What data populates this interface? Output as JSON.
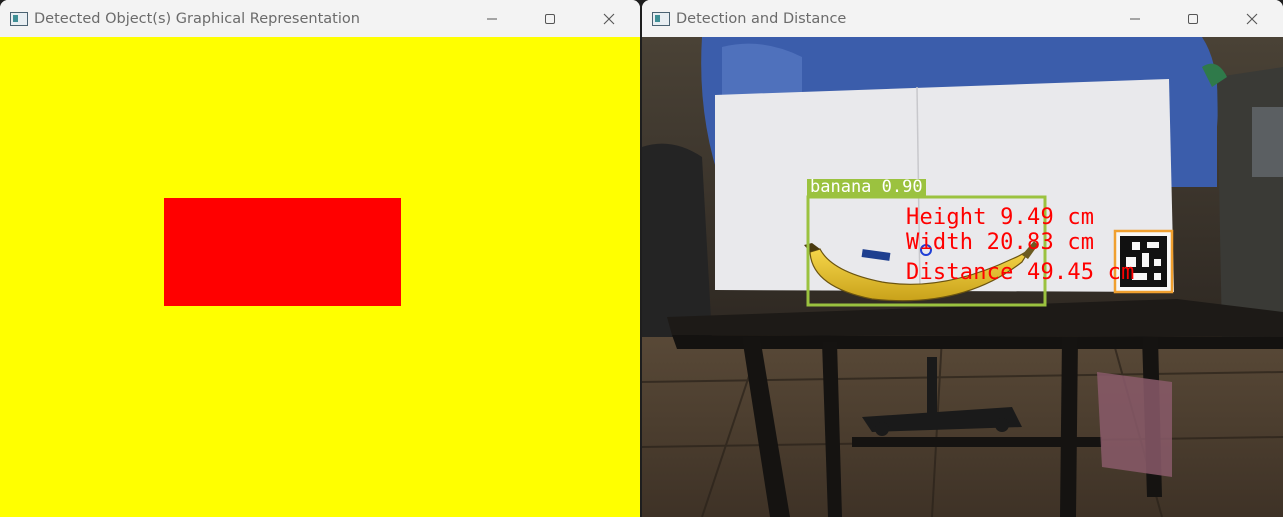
{
  "windows": {
    "left": {
      "title": "Detected Object(s) Graphical Representation",
      "background_color": "#ffff00",
      "shape_color": "#ff0000"
    },
    "right": {
      "title": "Detection and Distance",
      "detection": {
        "label": "banana 0.90",
        "box_color": "#9bc23f",
        "height_text": "Height 9.49 cm",
        "width_text": "Width 20.83 cm",
        "distance_text": "Distance 49.45 cm",
        "text_color": "#ff0000",
        "marker_color": "#1f3fd6",
        "marker_box_color": "#f0a030"
      }
    }
  },
  "icons": {
    "app": "app-window-icon",
    "minimize": "minimize-icon",
    "maximize": "maximize-icon",
    "close": "close-icon"
  }
}
